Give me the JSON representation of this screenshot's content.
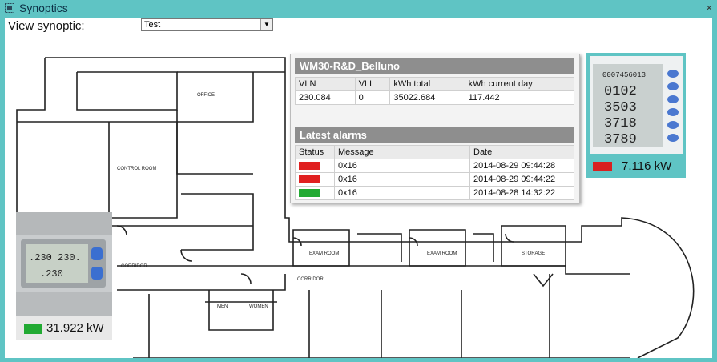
{
  "window": {
    "title": "Synoptics",
    "close_glyph": "×"
  },
  "toolbar": {
    "view_label": "View synoptic:",
    "selected": "Test"
  },
  "floorplan": {
    "rooms": [
      "OFFICE",
      "CONTROL ROOM",
      "CORRIDOR",
      "CORRIDOR",
      "EXAM ROOM",
      "EXAM ROOM",
      "STORAGE",
      "MEN",
      "WOMEN"
    ]
  },
  "popup": {
    "device_name": "WM30-R&D_Belluno",
    "headers": [
      "VLN",
      "VLL",
      "kWh total",
      "kWh current day"
    ],
    "values": [
      "230.084",
      "0",
      "35022.684",
      "117.442"
    ],
    "alarms_title": "Latest alarms",
    "alarm_headers": [
      "Status",
      "Message",
      "Date"
    ],
    "alarms": [
      {
        "color": "#e02020",
        "message": "0x16",
        "date": "2014-08-29 09:44:28"
      },
      {
        "color": "#e02020",
        "message": "0x16",
        "date": "2014-08-29 09:44:22"
      },
      {
        "color": "#22aa33",
        "message": "0x16",
        "date": "2014-08-28 14:32:22"
      }
    ]
  },
  "meters": {
    "left": {
      "value": "31.922 kW",
      "status_color": "#22aa33",
      "display": [
        ".230 230.",
        ".230"
      ]
    },
    "right": {
      "value": "7.116 kW",
      "status_color": "#d82020",
      "display": [
        "0007456013",
        "0102",
        "3503",
        "3718",
        "3789"
      ]
    }
  }
}
